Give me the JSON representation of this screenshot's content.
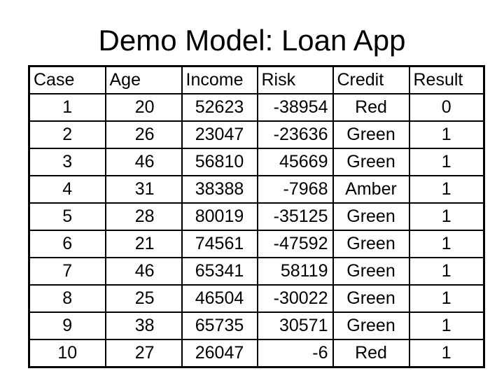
{
  "title": "Demo Model: Loan App",
  "table": {
    "headers": [
      "Case",
      "Age",
      "Income",
      "Risk",
      "Credit",
      "Result"
    ],
    "rows": [
      {
        "case": "1",
        "age": "20",
        "income": "52623",
        "risk": "-38954",
        "credit": "Red",
        "result": "0"
      },
      {
        "case": "2",
        "age": "26",
        "income": "23047",
        "risk": "-23636",
        "credit": "Green",
        "result": "1"
      },
      {
        "case": "3",
        "age": "46",
        "income": "56810",
        "risk": "45669",
        "credit": "Green",
        "result": "1"
      },
      {
        "case": "4",
        "age": "31",
        "income": "38388",
        "risk": "-7968",
        "credit": "Amber",
        "result": "1"
      },
      {
        "case": "5",
        "age": "28",
        "income": "80019",
        "risk": "-35125",
        "credit": "Green",
        "result": "1"
      },
      {
        "case": "6",
        "age": "21",
        "income": "74561",
        "risk": "-47592",
        "credit": "Green",
        "result": "1"
      },
      {
        "case": "7",
        "age": "46",
        "income": "65341",
        "risk": "58119",
        "credit": "Green",
        "result": "1"
      },
      {
        "case": "8",
        "age": "25",
        "income": "46504",
        "risk": "-30022",
        "credit": "Green",
        "result": "1"
      },
      {
        "case": "9",
        "age": "38",
        "income": "65735",
        "risk": "30571",
        "credit": "Green",
        "result": "1"
      },
      {
        "case": "10",
        "age": "27",
        "income": "26047",
        "risk": "-6",
        "credit": "Red",
        "result": "1"
      }
    ]
  }
}
